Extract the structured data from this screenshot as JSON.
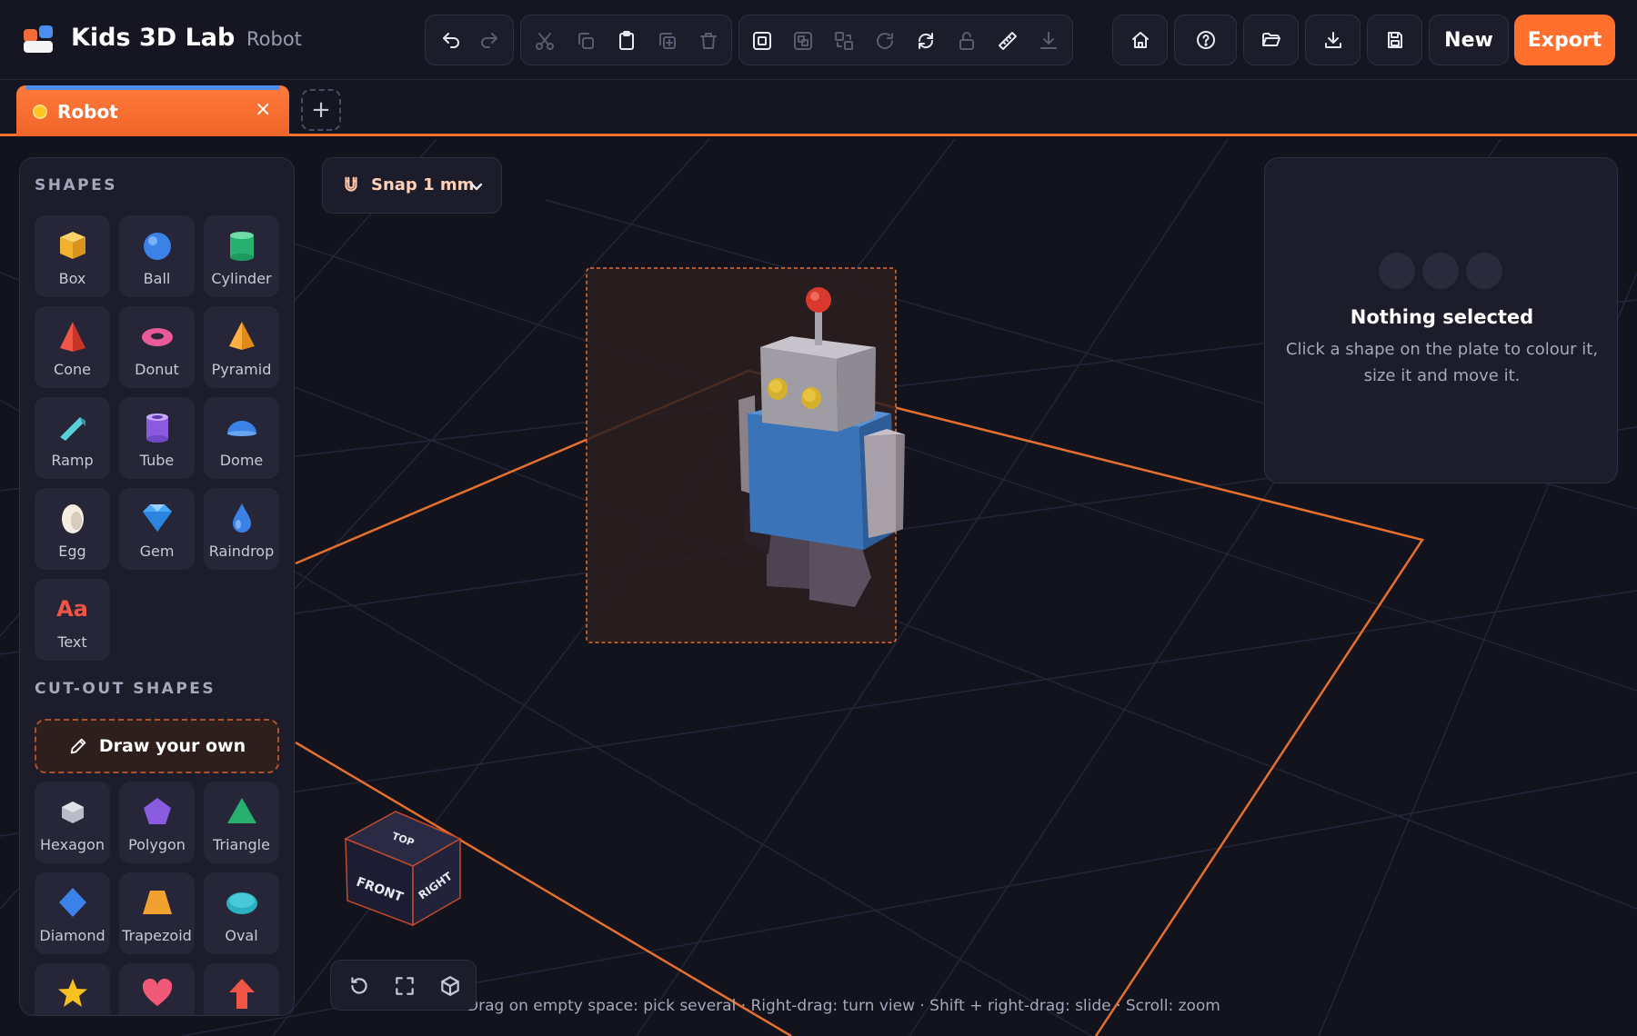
{
  "app": {
    "title": "Kids 3D Lab",
    "document_name": "Robot"
  },
  "toolbar": {
    "groups": [
      {
        "name": "history",
        "buttons": [
          {
            "icon": "undo-icon",
            "enabled": true
          },
          {
            "icon": "redo-icon",
            "enabled": false
          }
        ]
      },
      {
        "name": "edit",
        "buttons": [
          {
            "icon": "cut-icon",
            "enabled": false
          },
          {
            "icon": "copy-icon",
            "enabled": false
          },
          {
            "icon": "paste-icon",
            "enabled": true
          },
          {
            "icon": "duplicate-icon",
            "enabled": false
          },
          {
            "icon": "delete-icon",
            "enabled": false
          }
        ]
      },
      {
        "name": "arrange",
        "buttons": [
          {
            "icon": "select-all-icon",
            "enabled": true
          },
          {
            "icon": "group-icon",
            "enabled": false
          },
          {
            "icon": "align-icon",
            "enabled": false
          },
          {
            "icon": "rotate-icon",
            "enabled": false
          },
          {
            "icon": "flip-icon",
            "enabled": true
          },
          {
            "icon": "unlock-icon",
            "enabled": false
          },
          {
            "icon": "ruler-icon",
            "enabled": true
          },
          {
            "icon": "drop-to-plate-icon",
            "enabled": false
          }
        ]
      }
    ],
    "right": {
      "home_icon": "home-icon",
      "help_icon": "help-icon",
      "open_icon": "folder-open-icon",
      "download_icon": "download-icon",
      "save_icon": "save-icon",
      "new_label": "New",
      "export_label": "Export"
    }
  },
  "tabs": [
    {
      "label": "Robot",
      "active": true
    }
  ],
  "tab_add_label": "+",
  "tab_close_label": "×",
  "sidebar": {
    "shapes_title": "SHAPES",
    "shapes": [
      {
        "label": "Box",
        "icon": "box-icon"
      },
      {
        "label": "Ball",
        "icon": "ball-icon"
      },
      {
        "label": "Cylinder",
        "icon": "cylinder-icon"
      },
      {
        "label": "Cone",
        "icon": "cone-icon"
      },
      {
        "label": "Donut",
        "icon": "donut-icon"
      },
      {
        "label": "Pyramid",
        "icon": "pyramid-icon"
      },
      {
        "label": "Ramp",
        "icon": "ramp-icon"
      },
      {
        "label": "Tube",
        "icon": "tube-icon"
      },
      {
        "label": "Dome",
        "icon": "dome-icon"
      },
      {
        "label": "Egg",
        "icon": "egg-icon"
      },
      {
        "label": "Gem",
        "icon": "gem-icon"
      },
      {
        "label": "Raindrop",
        "icon": "raindrop-icon"
      },
      {
        "label": "Text",
        "icon": "text-icon",
        "glyph": "Aa"
      }
    ],
    "cutout_title": "CUT-OUT SHAPES",
    "draw_own_label": "Draw your own",
    "cutouts": [
      {
        "label": "Hexagon",
        "icon": "hexagon-icon"
      },
      {
        "label": "Polygon",
        "icon": "polygon-icon"
      },
      {
        "label": "Triangle",
        "icon": "triangle-icon"
      },
      {
        "label": "Diamond",
        "icon": "diamond-icon"
      },
      {
        "label": "Trapezoid",
        "icon": "trapezoid-icon"
      },
      {
        "label": "Oval",
        "icon": "oval-icon"
      },
      {
        "label": "",
        "icon": "star-icon"
      },
      {
        "label": "",
        "icon": "heart-icon"
      },
      {
        "label": "",
        "icon": "arrow-up-icon"
      }
    ]
  },
  "snap": {
    "label": "Snap 1 mm",
    "icon": "magnet-icon"
  },
  "selection": {
    "title": "Nothing selected",
    "description": "Click a shape on the plate to colour it, size it and move it."
  },
  "view_cube": {
    "top": "TOP",
    "front": "FRONT",
    "right": "RIGHT"
  },
  "view_controls": [
    {
      "icon": "reset-view-icon"
    },
    {
      "icon": "fit-view-icon"
    },
    {
      "icon": "perspective-icon"
    }
  ],
  "hint": "Drag on empty space: pick several · Right-drag: turn view · Shift + right-drag: slide · Scroll: zoom",
  "colors": {
    "accent": "#ff6f2e",
    "panel": "#1c1c2a",
    "background": "#13131d"
  }
}
